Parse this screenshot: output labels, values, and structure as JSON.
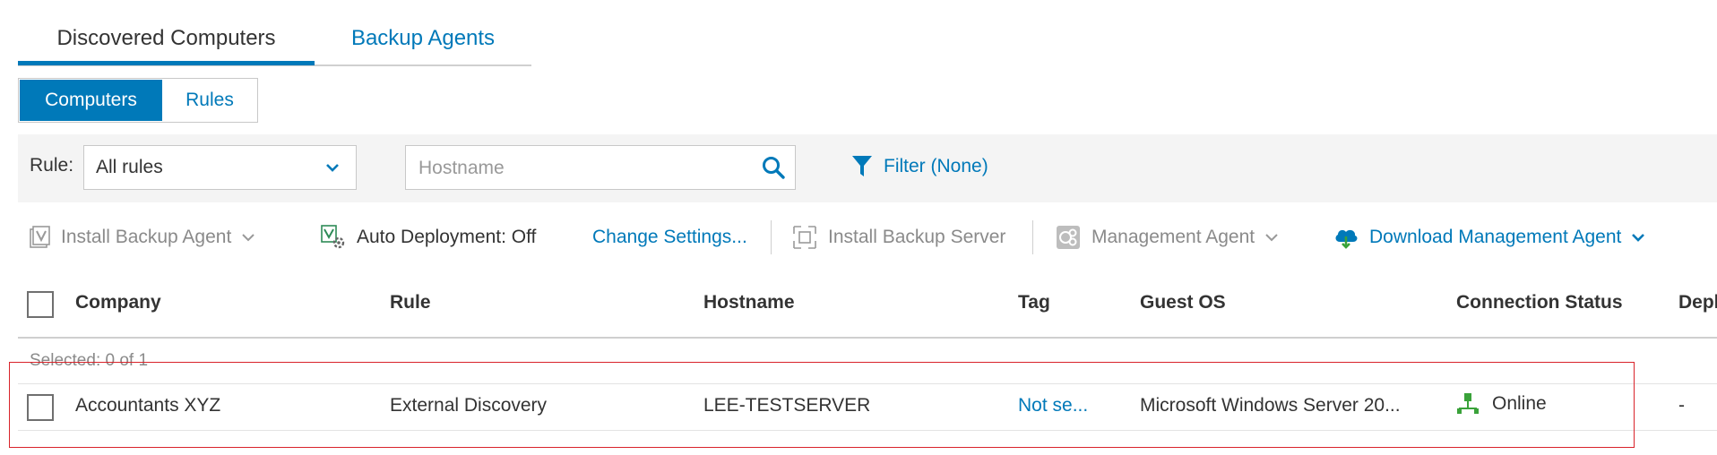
{
  "top_tabs": [
    {
      "label": "Discovered Computers",
      "active": true
    },
    {
      "label": "Backup Agents",
      "active": false
    }
  ],
  "segmented": {
    "computers": "Computers",
    "rules": "Rules",
    "active": "Computers"
  },
  "filters": {
    "rule_label": "Rule:",
    "rule_value": "All rules",
    "hostname_placeholder": "Hostname",
    "filter_label": "Filter (None)"
  },
  "toolbar": {
    "install_backup_agent": "Install Backup Agent",
    "auto_deployment": "Auto Deployment: Off",
    "change_settings": "Change Settings...",
    "install_backup_server": "Install Backup Server",
    "management_agent": "Management Agent",
    "download_management_agent": "Download Management Agent"
  },
  "table": {
    "columns": [
      "Company",
      "Rule",
      "Hostname",
      "Tag",
      "Guest OS",
      "Connection Status",
      "Depl"
    ],
    "selected_text": "Selected: 0 of 1",
    "rows": [
      {
        "company": "Accountants XYZ",
        "rule": "External Discovery",
        "hostname": "LEE-TESTSERVER",
        "tag": "Not se...",
        "guest_os": "Microsoft Windows Server 20...",
        "connection_status": "Online",
        "deployment": "-"
      }
    ]
  },
  "colors": {
    "accent": "#0079b9",
    "highlight_box": "#d9232a",
    "online_icon": "#3aa23a"
  }
}
